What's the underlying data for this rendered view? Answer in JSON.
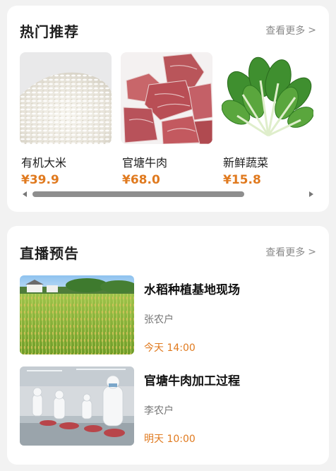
{
  "hot": {
    "title": "热门推荐",
    "more": "查看更多",
    "products": [
      {
        "name": "有机大米",
        "price": "¥39.9",
        "image": "rice-photo"
      },
      {
        "name": "官塘牛肉",
        "price": "¥68.0",
        "image": "beef-photo"
      },
      {
        "name": "新鲜蔬菜",
        "price": "¥15.8",
        "image": "vegetables-photo"
      }
    ],
    "scroll_position": 0.0,
    "scroll_visible_fraction": 0.78
  },
  "live": {
    "title": "直播预告",
    "more": "查看更多",
    "items": [
      {
        "title": "水稻种植基地现场",
        "host": "张农户",
        "time": "今天 14:00",
        "image": "rice-field-photo"
      },
      {
        "title": "官塘牛肉加工过程",
        "host": "李农户",
        "time": "明天 10:00",
        "image": "meat-processing-photo"
      }
    ]
  },
  "colors": {
    "accent": "#e07a1f",
    "muted": "#8a8a8a",
    "background": "#f2f2f2"
  }
}
